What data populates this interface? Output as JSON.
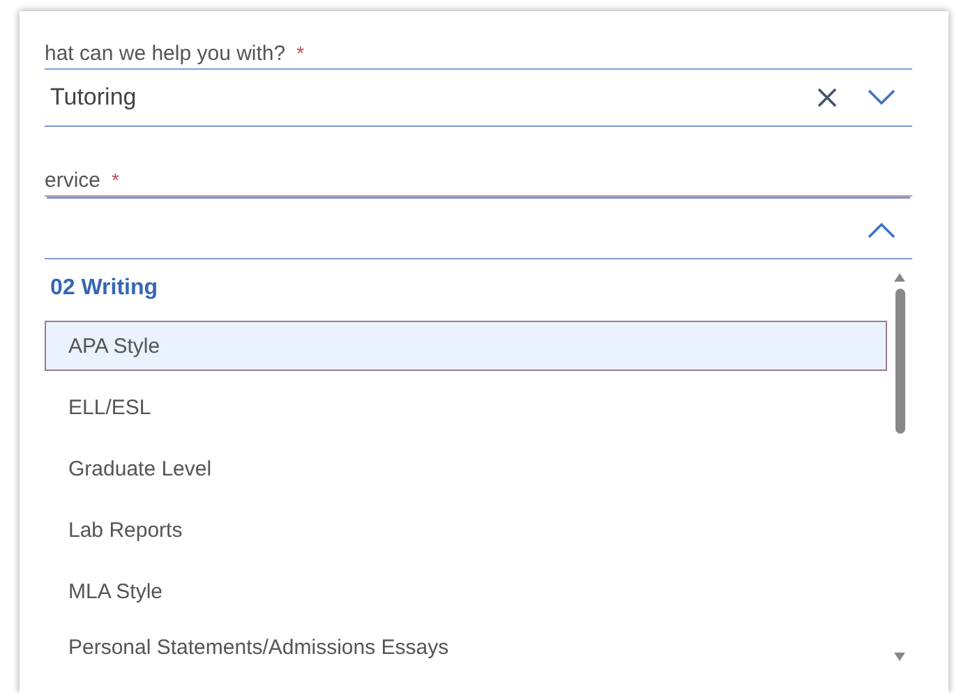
{
  "fields": [
    {
      "label": "hat can we help you with?",
      "required_mark": "*",
      "value": "Tutoring",
      "clearable": true,
      "expanded": false
    },
    {
      "label": "ervice",
      "required_mark": "*",
      "clearable": false,
      "expanded": true
    }
  ],
  "dropdown": {
    "group": "02 Writing",
    "items": [
      {
        "label": "APA Style",
        "selected": true
      },
      {
        "label": "ELL/ESL",
        "selected": false
      },
      {
        "label": "Graduate Level",
        "selected": false
      },
      {
        "label": "Lab Reports",
        "selected": false
      },
      {
        "label": "MLA Style",
        "selected": false
      },
      {
        "label": "Personal Statements/Admissions Essays",
        "selected": false
      }
    ]
  }
}
